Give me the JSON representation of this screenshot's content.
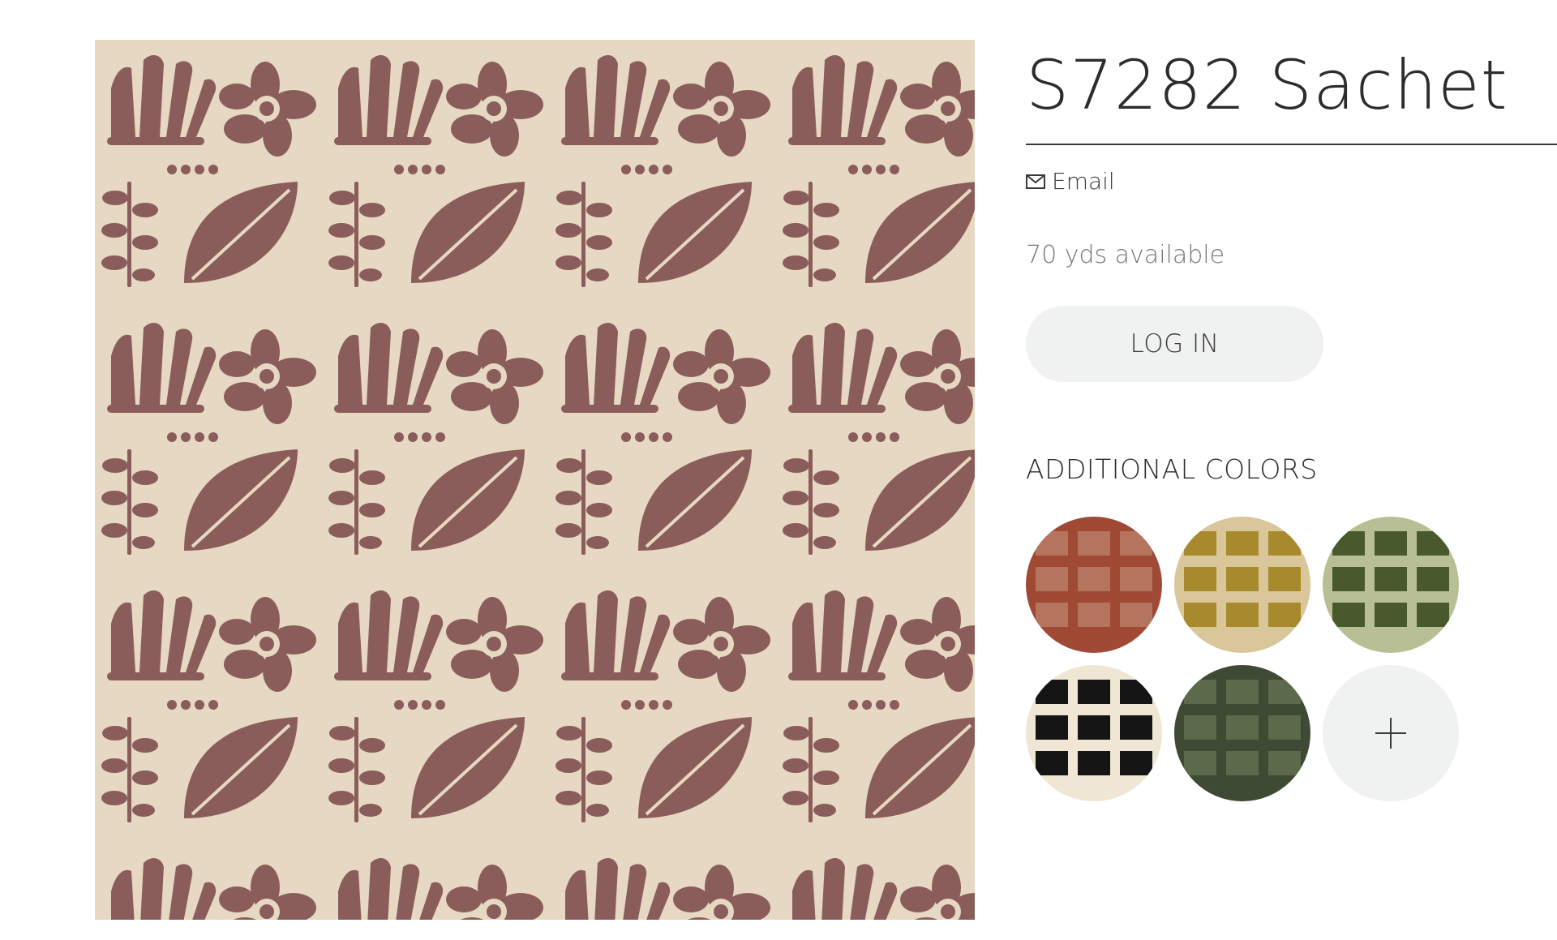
{
  "product": {
    "title": "S7282 Sachet",
    "email_label": "Email",
    "availability": "70 yds available",
    "login_label": "LOG IN",
    "colors": {
      "background": "#e6d8c2",
      "motif": "#8a5d5a"
    }
  },
  "additional_colors": {
    "heading": "ADDITIONAL COLORS",
    "swatches": [
      {
        "name": "rust",
        "ground": "#d9c2a8",
        "motif": "#a04a36"
      },
      {
        "name": "ochre",
        "ground": "#d9c79a",
        "motif": "#a88a2e"
      },
      {
        "name": "olive",
        "ground": "#b9bf95",
        "motif": "#485a2c"
      },
      {
        "name": "black",
        "ground": "#efe6d4",
        "motif": "#151515"
      },
      {
        "name": "forest",
        "ground": "#3e4a34",
        "motif": "#5a6a4a"
      }
    ],
    "more_icon": "plus-icon"
  },
  "icons": {
    "email": "envelope-icon",
    "more": "plus-icon"
  }
}
